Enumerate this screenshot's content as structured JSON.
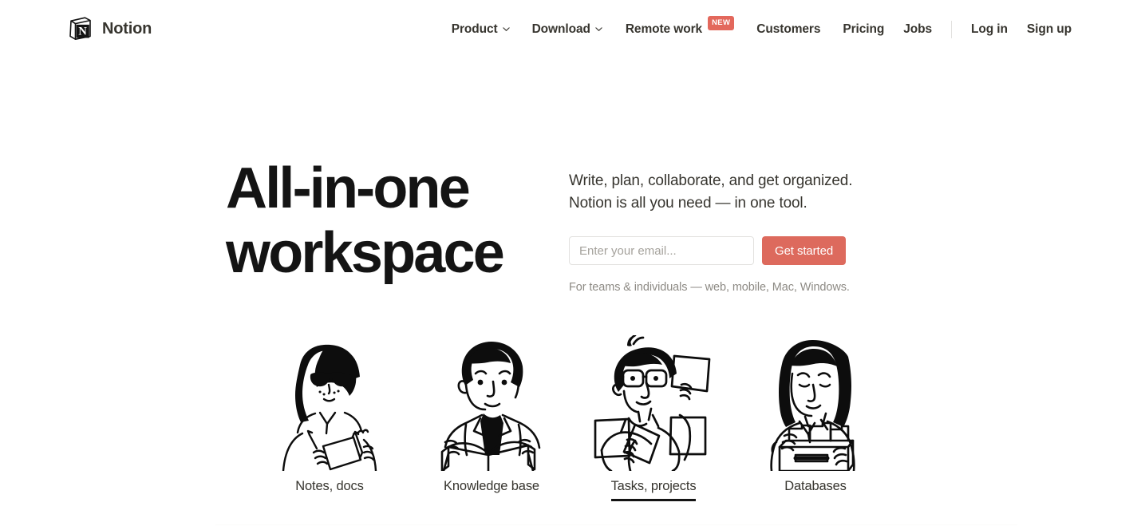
{
  "brand": {
    "name": "Notion",
    "logo_icon": "notion-cube-icon",
    "logo_letter": "N"
  },
  "nav": {
    "items": [
      {
        "label": "Product",
        "has_caret": true,
        "badge": null,
        "name": "product"
      },
      {
        "label": "Download",
        "has_caret": true,
        "badge": null,
        "name": "download"
      },
      {
        "label": "Remote work",
        "has_caret": false,
        "badge": "NEW",
        "name": "remote-work"
      },
      {
        "label": "Customers",
        "has_caret": false,
        "badge": null,
        "name": "customers"
      },
      {
        "label": "Pricing",
        "has_caret": false,
        "badge": null,
        "name": "pricing"
      },
      {
        "label": "Jobs",
        "has_caret": false,
        "badge": null,
        "name": "jobs"
      }
    ],
    "auth": [
      {
        "label": "Log in",
        "name": "log-in"
      },
      {
        "label": "Sign up",
        "name": "sign-up"
      }
    ],
    "badge_color": "#e3685c",
    "caret_icon": "chevron-down-icon",
    "divider_name": "nav-divider"
  },
  "hero": {
    "title_line_1": "All-in-one",
    "title_line_2": "workspace",
    "subtitle_line_1": "Write, plan, collaborate, and get organized.",
    "subtitle_line_2": "Notion is all you need — in one tool.",
    "email_placeholder": "Enter your email...",
    "email_value": "",
    "cta_label": "Get started",
    "cta_color": "#dd6a5d",
    "note": "For teams & individuals — web, mobile, Mac, Windows."
  },
  "features": {
    "tabs": [
      {
        "label": "Notes, docs",
        "active": false,
        "illustration": "person-writing-notepad-illustration",
        "name": "notes-docs"
      },
      {
        "label": "Knowledge base",
        "active": false,
        "illustration": "person-reading-book-illustration",
        "name": "knowledge-base"
      },
      {
        "label": "Tasks, projects",
        "active": true,
        "illustration": "person-holding-cards-illustration",
        "name": "tasks-projects"
      },
      {
        "label": "Databases",
        "active": false,
        "illustration": "person-sorting-folders-illustration",
        "name": "databases"
      }
    ]
  }
}
